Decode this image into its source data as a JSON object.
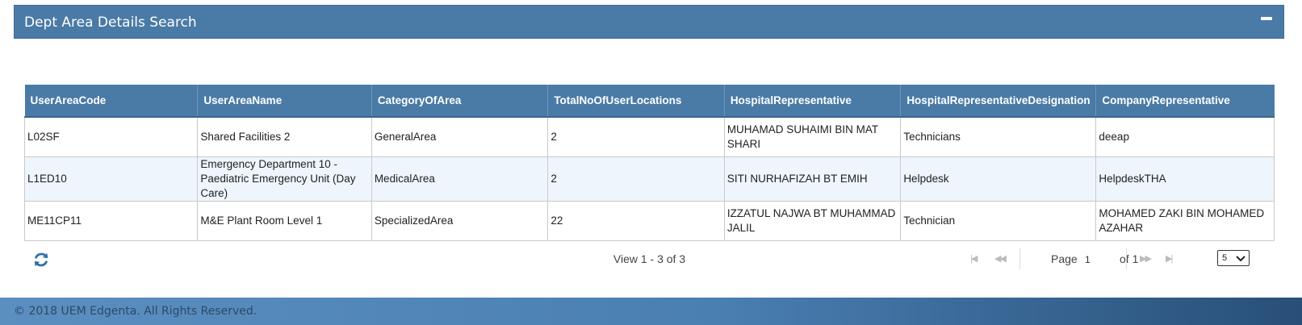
{
  "panel": {
    "title": "Dept Area Details Search"
  },
  "table": {
    "columns": [
      "UserAreaCode",
      "UserAreaName",
      "CategoryOfArea",
      "TotalNoOfUserLocations",
      "HospitalRepresentative",
      "HospitalRepresentativeDesignation",
      "CompanyRepresentative"
    ],
    "rows": [
      [
        "L02SF",
        "Shared Facilities 2",
        "GeneralArea",
        "2",
        "MUHAMAD SUHAIMI BIN MAT SHARI",
        "Technicians",
        "deeap"
      ],
      [
        "L1ED10",
        "Emergency Department 10 - Paediatric Emergency Unit (Day Care)",
        "MedicalArea",
        "2",
        "SITI NURHAFIZAH BT EMIH",
        "Helpdesk",
        "HelpdeskTHA"
      ],
      [
        "ME11CP11",
        "M&E Plant Room Level 1",
        "SpecializedArea",
        "22",
        "IZZATUL NAJWA BT MUHAMMAD JALIL",
        "Technician",
        "MOHAMED ZAKI BIN MOHAMED AZAHAR"
      ]
    ]
  },
  "pager": {
    "view_text": "View 1 - 3 of 3",
    "page_label": "Page",
    "page_value": "1",
    "of_text": "of 1",
    "rows_per_page": "5"
  },
  "footer": {
    "text": "© 2018 UEM Edgenta. All Rights Reserved."
  },
  "icons": {
    "collapse": "minus-icon",
    "refresh": "refresh-icon",
    "first": "first-page-icon",
    "prev": "prev-page-icon",
    "next": "next-page-icon",
    "last": "last-page-icon",
    "dropdown": "chevron-down-icon"
  },
  "colors": {
    "header": "#4a7aa6",
    "alt_row": "#eef5fc",
    "footer": "#4a7fb2"
  }
}
